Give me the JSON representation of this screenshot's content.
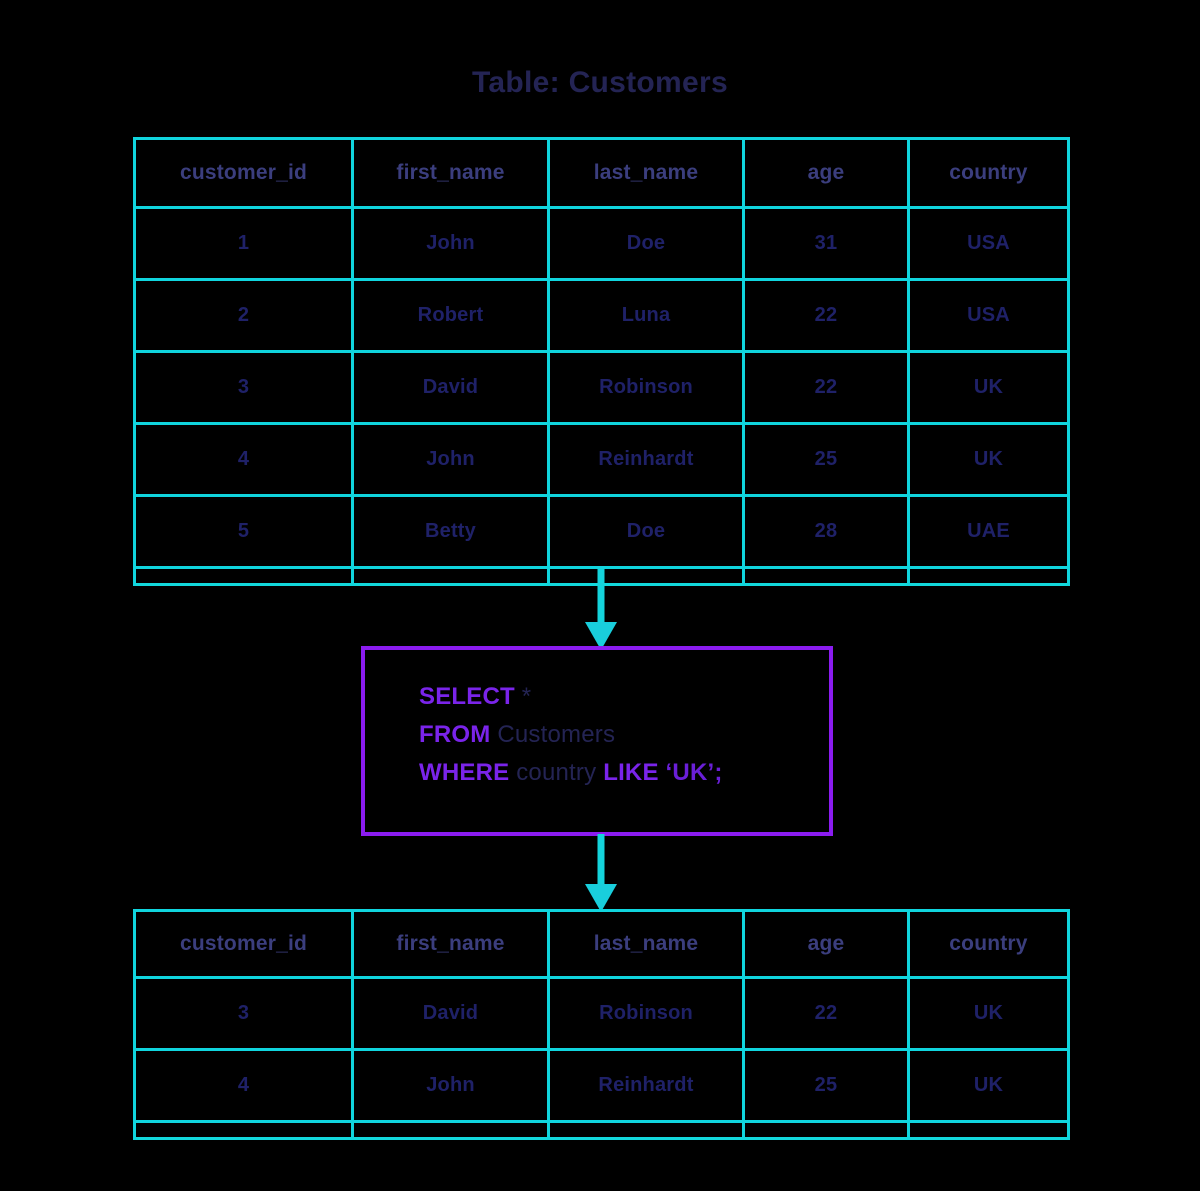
{
  "title": "Table: Customers",
  "colors": {
    "background": "#000000",
    "table_border": "#12D8DC",
    "arrow": "#14D4DC",
    "header_text": "#3B3E7E",
    "cell_text": "#1F2168",
    "title_text": "#242454",
    "sql_box_border": "#8B1CF0",
    "sql_keyword": "#7A24EA",
    "sql_literal": "#242454",
    "sql_string": "#6A1FD8"
  },
  "source_table": {
    "name": "Customers",
    "columns": [
      "customer_id",
      "first_name",
      "last_name",
      "age",
      "country"
    ],
    "rows": [
      [
        "1",
        "John",
        "Doe",
        "31",
        "USA"
      ],
      [
        "2",
        "Robert",
        "Luna",
        "22",
        "USA"
      ],
      [
        "3",
        "David",
        "Robinson",
        "22",
        "UK"
      ],
      [
        "4",
        "John",
        "Reinhardt",
        "25",
        "UK"
      ],
      [
        "5",
        "Betty",
        "Doe",
        "28",
        "UAE"
      ]
    ]
  },
  "query": {
    "line1": {
      "keyword": "SELECT",
      "rest": "*"
    },
    "line2": {
      "keyword": "FROM",
      "rest": "Customers"
    },
    "line3": {
      "keyword": "WHERE",
      "column": "country",
      "keyword2": "LIKE",
      "value": "‘UK’;"
    },
    "full_text": "SELECT * FROM Customers WHERE country LIKE ‘UK’;"
  },
  "result_table": {
    "columns": [
      "customer_id",
      "first_name",
      "last_name",
      "age",
      "country"
    ],
    "rows": [
      [
        "3",
        "David",
        "Robinson",
        "22",
        "UK"
      ],
      [
        "4",
        "John",
        "Reinhardt",
        "25",
        "UK"
      ]
    ]
  },
  "arrows": [
    {
      "name": "arrow-source-to-query",
      "direction": "down"
    },
    {
      "name": "arrow-query-to-result",
      "direction": "down"
    }
  ]
}
